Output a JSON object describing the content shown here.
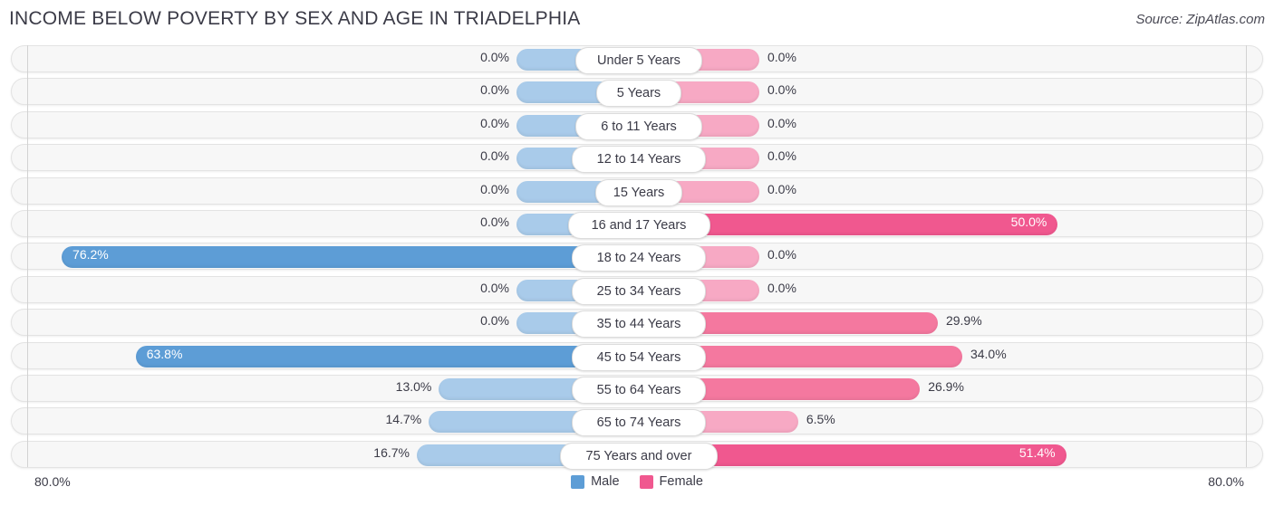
{
  "header": {
    "title": "INCOME BELOW POVERTY BY SEX AND AGE IN TRIADELPHIA",
    "source": "Source: ZipAtlas.com"
  },
  "axis": {
    "left_max_label": "80.0%",
    "right_max_label": "80.0%",
    "max": 80.0
  },
  "legend": {
    "items": [
      {
        "label": "Male",
        "color": "#5d9dd6"
      },
      {
        "label": "Female",
        "color": "#f0588f"
      }
    ]
  },
  "colors": {
    "male_light": "#a9cbea",
    "male_strong": "#5d9dd6",
    "female_light": "#f7a9c4",
    "female_mid": "#f4789f",
    "female_strong": "#f0588f",
    "row_background": "#f7f7f7",
    "row_border": "#e3e3e3",
    "text": "#3b3b47"
  },
  "chart_data": {
    "type": "bar",
    "orientation": "horizontal-diverging",
    "title": "INCOME BELOW POVERTY BY SEX AND AGE IN TRIADELPHIA",
    "xlabel": "",
    "ylabel": "",
    "xlim": [
      -80.0,
      80.0
    ],
    "grid": false,
    "legend_position": "bottom-center",
    "categories": [
      "Under 5 Years",
      "5 Years",
      "6 to 11 Years",
      "12 to 14 Years",
      "15 Years",
      "16 and 17 Years",
      "18 to 24 Years",
      "25 to 34 Years",
      "35 to 44 Years",
      "45 to 54 Years",
      "55 to 64 Years",
      "65 to 74 Years",
      "75 Years and over"
    ],
    "series": [
      {
        "name": "Male",
        "side": "left",
        "values": [
          0.0,
          0.0,
          0.0,
          0.0,
          0.0,
          0.0,
          76.2,
          0.0,
          0.0,
          63.8,
          13.0,
          14.7,
          16.7
        ],
        "labels": [
          "0.0%",
          "0.0%",
          "0.0%",
          "0.0%",
          "0.0%",
          "0.0%",
          "76.2%",
          "0.0%",
          "0.0%",
          "63.8%",
          "13.0%",
          "14.7%",
          "16.7%"
        ]
      },
      {
        "name": "Female",
        "side": "right",
        "values": [
          0.0,
          0.0,
          0.0,
          0.0,
          0.0,
          50.0,
          0.0,
          0.0,
          29.9,
          34.0,
          26.9,
          6.5,
          51.4
        ],
        "labels": [
          "0.0%",
          "0.0%",
          "0.0%",
          "0.0%",
          "0.0%",
          "50.0%",
          "0.0%",
          "0.0%",
          "29.9%",
          "34.0%",
          "26.9%",
          "6.5%",
          "51.4%"
        ]
      }
    ]
  }
}
